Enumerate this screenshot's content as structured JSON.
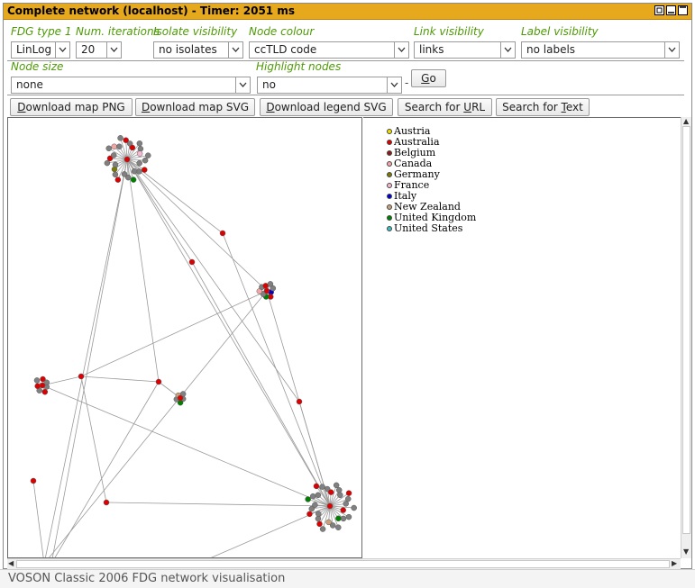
{
  "window": {
    "title": "Complete network (localhost) - Timer: 2051 ms",
    "buttons": [
      "restore-icon",
      "minimize-icon",
      "maximize-icon",
      "close-icon"
    ]
  },
  "controls": {
    "fdg_type": {
      "label": "FDG type 1",
      "value": "LinLog"
    },
    "iterations": {
      "label": "Num. iterations",
      "value": "20"
    },
    "isolates": {
      "label": "Isolate visibility",
      "value": "no isolates"
    },
    "node_colour": {
      "label": "Node colour",
      "value": "ccTLD code"
    },
    "link_visibility": {
      "label": "Link visibility",
      "value": "links"
    },
    "label_visibility": {
      "label": "Label visibility",
      "value": "no labels"
    },
    "node_size": {
      "label": "Node size",
      "value": "none"
    },
    "highlight": {
      "label": "Highlight nodes",
      "value": "no"
    },
    "dash": "-",
    "go_button": {
      "pre": "",
      "key": "G",
      "post": "o"
    }
  },
  "actions": {
    "download_png": {
      "key": "D",
      "post": "ownload map PNG"
    },
    "download_svg": {
      "key": "D",
      "post": "ownload map SVG"
    },
    "download_legend": {
      "key": "D",
      "post": "ownload legend SVG"
    },
    "search_url": {
      "pre": "Search for ",
      "key": "U",
      "post": "RL"
    },
    "search_text": {
      "pre": "Search for ",
      "key": "T",
      "post": "ext"
    }
  },
  "legend": [
    {
      "label": "Austria",
      "color": "#f0e000"
    },
    {
      "label": "Australia",
      "color": "#dd0000"
    },
    {
      "label": "Belgium",
      "color": "#8b1a1a"
    },
    {
      "label": "Canada",
      "color": "#f4a6a6"
    },
    {
      "label": "Germany",
      "color": "#7a7a00"
    },
    {
      "label": "France",
      "color": "#f5b8d0"
    },
    {
      "label": "Italy",
      "color": "#0000cc"
    },
    {
      "label": "New Zealand",
      "color": "#c8a27c"
    },
    {
      "label": "United Kingdom",
      "color": "#008000"
    },
    {
      "label": "United States",
      "color": "#3fbfbf"
    }
  ],
  "status": "VOSON Classic 2006 FDG network visualisation",
  "colors": {
    "titlebar": "#e6a91e",
    "label": "#4e9a06",
    "default_node": "#808080",
    "hub_node": "#dd0000"
  }
}
